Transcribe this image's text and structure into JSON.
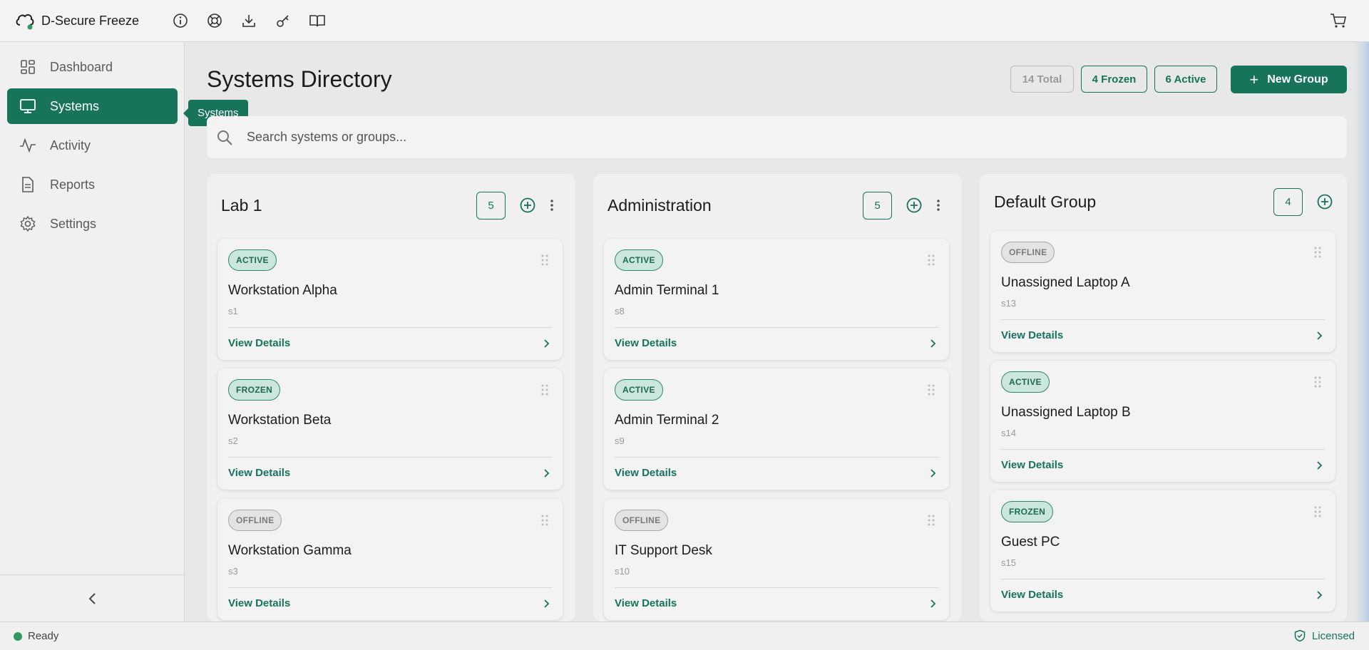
{
  "app": {
    "title": "D-Secure Freeze"
  },
  "toolbar": {
    "icons": [
      "info-icon",
      "support-icon",
      "download-icon",
      "key-icon",
      "book-icon",
      "cart-icon"
    ]
  },
  "sidebar": {
    "items": [
      {
        "label": "Dashboard",
        "icon": "dashboard-icon",
        "active": false
      },
      {
        "label": "Systems",
        "icon": "monitor-icon",
        "active": true
      },
      {
        "label": "Activity",
        "icon": "activity-icon",
        "active": false
      },
      {
        "label": "Reports",
        "icon": "document-icon",
        "active": false
      },
      {
        "label": "Settings",
        "icon": "gear-icon",
        "active": false
      }
    ],
    "tooltip": "Systems"
  },
  "main": {
    "title": "Systems Directory",
    "stats": {
      "total": "14 Total",
      "frozen": "4 Frozen",
      "active": "6 Active"
    },
    "new_group_label": "New Group",
    "search_placeholder": "Search systems or groups..."
  },
  "groups": [
    {
      "name": "Lab 1",
      "count": "5",
      "systems": [
        {
          "status": "ACTIVE",
          "name": "Workstation Alpha",
          "id": "s1",
          "link": "View Details"
        },
        {
          "status": "FROZEN",
          "name": "Workstation Beta",
          "id": "s2",
          "link": "View Details"
        },
        {
          "status": "OFFLINE",
          "name": "Workstation Gamma",
          "id": "s3",
          "link": "View Details"
        }
      ]
    },
    {
      "name": "Administration",
      "count": "5",
      "systems": [
        {
          "status": "ACTIVE",
          "name": "Admin Terminal 1",
          "id": "s8",
          "link": "View Details"
        },
        {
          "status": "ACTIVE",
          "name": "Admin Terminal 2",
          "id": "s9",
          "link": "View Details"
        },
        {
          "status": "OFFLINE",
          "name": "IT Support Desk",
          "id": "s10",
          "link": "View Details"
        }
      ]
    },
    {
      "name": "Default Group",
      "count": "4",
      "systems": [
        {
          "status": "OFFLINE",
          "name": "Unassigned Laptop A",
          "id": "s13",
          "link": "View Details"
        },
        {
          "status": "ACTIVE",
          "name": "Unassigned Laptop B",
          "id": "s14",
          "link": "View Details"
        },
        {
          "status": "FROZEN",
          "name": "Guest PC",
          "id": "s15",
          "link": "View Details"
        }
      ]
    }
  ],
  "statusbar": {
    "status": "Ready",
    "license": "Licensed"
  },
  "colors": {
    "accent": "#17735a",
    "active_badge": "#cbe6da",
    "offline_badge": "#e3e3e3",
    "ready_dot": "#2e9a5f"
  }
}
